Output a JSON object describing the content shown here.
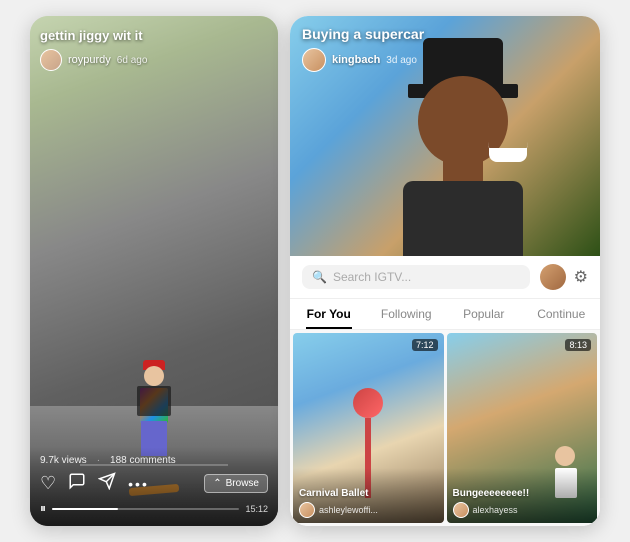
{
  "phones": {
    "left": {
      "video_title": "gettin jiggy wit it",
      "username": "roypurdy",
      "time_ago": "6d ago",
      "stats": {
        "views": "9.7k views",
        "separator": "·",
        "comments": "188 comments"
      },
      "browse_label": "Browse",
      "duration": "15:12",
      "actions": {
        "like_icon": "♡",
        "comment_icon": "💬",
        "share_icon": "➤",
        "more_icon": "•••"
      }
    },
    "right": {
      "video_title": "Buying a supercar",
      "username": "kingbach",
      "time_ago": "3d ago",
      "search_placeholder": "Search IGTV...",
      "tabs": [
        {
          "label": "For You",
          "active": true
        },
        {
          "label": "Following",
          "active": false
        },
        {
          "label": "Popular",
          "active": false
        },
        {
          "label": "Continue",
          "active": false
        }
      ],
      "thumbs": [
        {
          "title": "Carnival Ballet",
          "username": "ashleylewoffi...",
          "duration": "7:12"
        },
        {
          "title": "Bungeeeeeeee!!",
          "username": "alexhayess",
          "duration": "8:13"
        }
      ]
    }
  }
}
